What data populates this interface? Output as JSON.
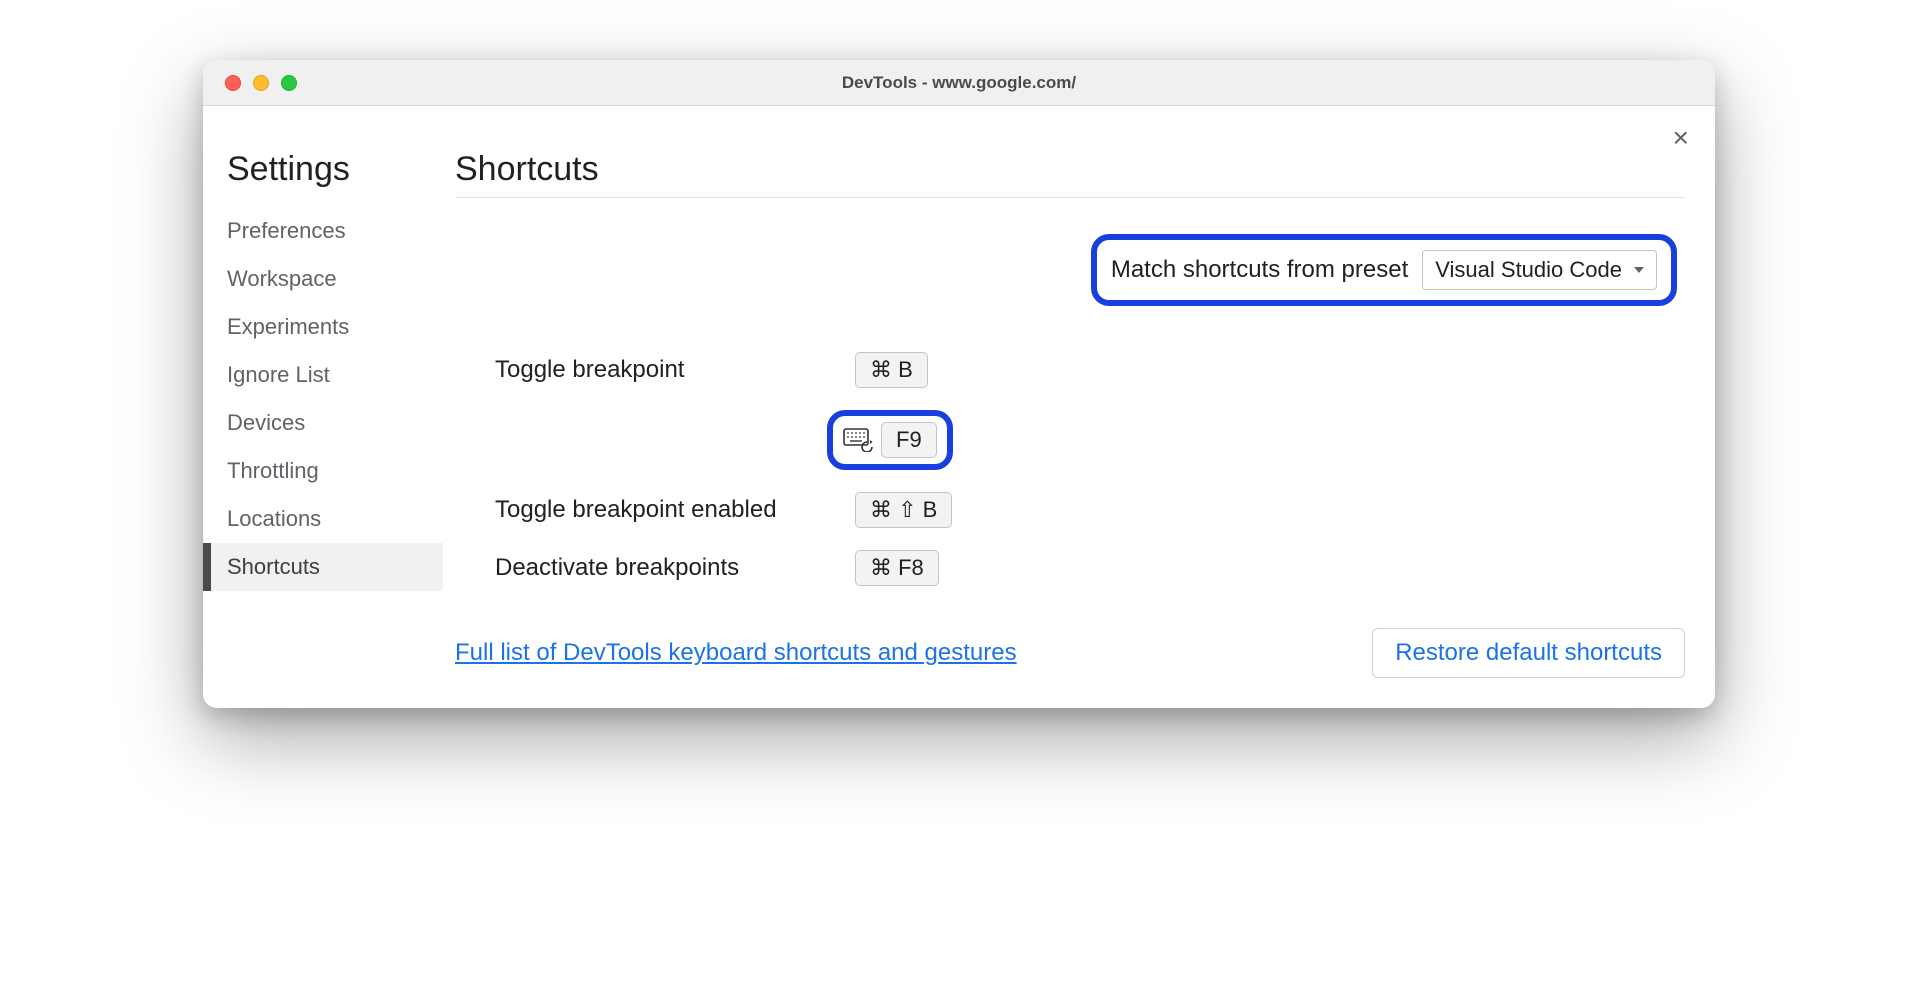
{
  "window": {
    "title": "DevTools - www.google.com/"
  },
  "sidebar": {
    "title": "Settings",
    "items": [
      {
        "label": "Preferences",
        "active": false
      },
      {
        "label": "Workspace",
        "active": false
      },
      {
        "label": "Experiments",
        "active": false
      },
      {
        "label": "Ignore List",
        "active": false
      },
      {
        "label": "Devices",
        "active": false
      },
      {
        "label": "Throttling",
        "active": false
      },
      {
        "label": "Locations",
        "active": false
      },
      {
        "label": "Shortcuts",
        "active": true
      }
    ]
  },
  "main": {
    "heading": "Shortcuts",
    "preset_label": "Match shortcuts from preset",
    "preset_value": "Visual Studio Code",
    "shortcuts": [
      {
        "name": "Toggle breakpoint",
        "keys": "⌘ B"
      },
      {
        "name_hidden": true,
        "keys": "F9",
        "highlighted": true,
        "has_reset_icon": true
      },
      {
        "name": "Toggle breakpoint enabled",
        "keys": "⌘ ⇧ B"
      },
      {
        "name": "Deactivate breakpoints",
        "keys": "⌘ F8"
      }
    ],
    "doc_link": "Full list of DevTools keyboard shortcuts and gestures",
    "restore_button": "Restore default shortcuts"
  }
}
